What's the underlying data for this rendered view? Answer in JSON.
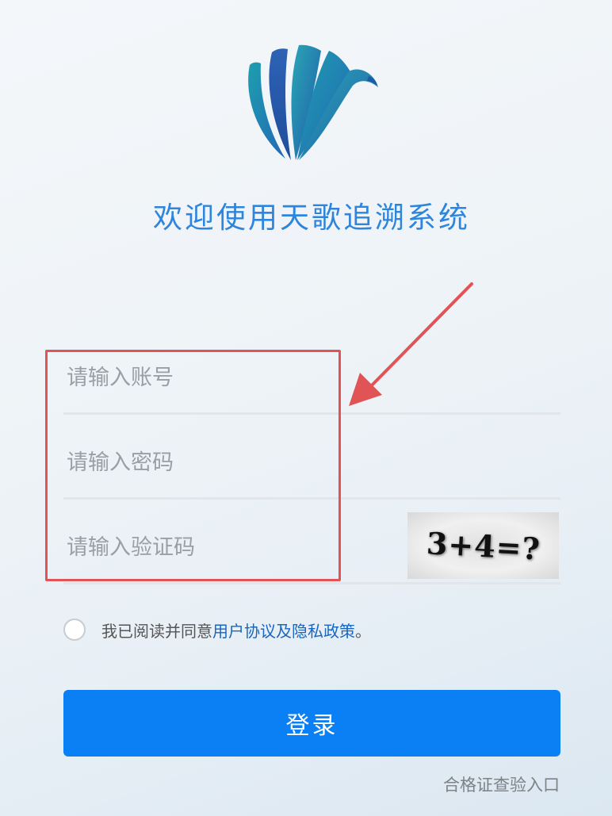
{
  "header": {
    "title": "欢迎使用天歌追溯系统"
  },
  "form": {
    "account_placeholder": "请输入账号",
    "password_placeholder": "请输入密码",
    "captcha_placeholder": "请输入验证码",
    "captcha_text": "3+4=?"
  },
  "agreement": {
    "prefix": "我已阅读并同意",
    "link_text": "用户协议及隐私政策",
    "suffix": "。",
    "checked": false
  },
  "login_button": {
    "label": "登录"
  },
  "footer": {
    "certificate_link": "合格证查验入口"
  },
  "colors": {
    "brand_blue": "#0b80f5",
    "title_blue": "#2d85dc",
    "annotation_red": "#e05456"
  },
  "icons": {
    "logo": "stylized-leaves-logo"
  }
}
